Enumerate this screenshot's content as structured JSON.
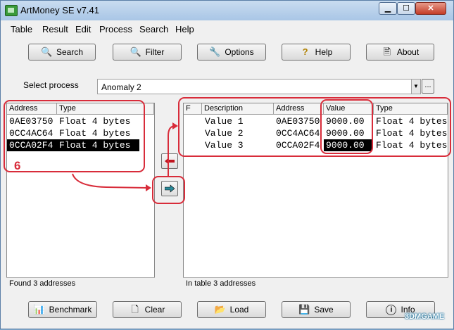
{
  "window": {
    "title": "ArtMoney SE v7.41"
  },
  "menu": [
    "Table",
    "Result",
    "Edit",
    "Process",
    "Search",
    "Help"
  ],
  "toolbar": {
    "search": "Search",
    "filter": "Filter",
    "options": "Options",
    "help": "Help",
    "about": "About"
  },
  "process": {
    "label": "Select process",
    "value": "Anomaly 2",
    "browse": "..."
  },
  "left_table": {
    "columns": [
      "Address",
      "Type"
    ],
    "rows": [
      {
        "address": "0AE03750",
        "type": "Float 4 bytes"
      },
      {
        "address": "0CC4AC64",
        "type": "Float 4 bytes"
      },
      {
        "address": "0CCA02F4",
        "type": "Float 4 bytes"
      }
    ],
    "selected_row": 2,
    "status": "Found 3 addresses"
  },
  "right_table": {
    "columns": [
      "F",
      "Description",
      "Address",
      "Value",
      "Type"
    ],
    "rows": [
      {
        "desc": "Value 1",
        "address": "0AE03750",
        "value": "9000.00",
        "type": "Float 4 bytes"
      },
      {
        "desc": "Value 2",
        "address": "0CC4AC64",
        "value": "9000.00",
        "type": "Float 4 bytes"
      },
      {
        "desc": "Value 3",
        "address": "0CCA02F4",
        "value": "9000.00",
        "type": "Float 4 bytes"
      }
    ],
    "status": "In table 3 addresses"
  },
  "annotation": {
    "step": "6",
    "color": "#d82c3a"
  },
  "bottom": {
    "benchmark": "Benchmark",
    "clear": "Clear",
    "load": "Load",
    "save": "Save",
    "info": "Info"
  },
  "watermark": "3DMGAME"
}
